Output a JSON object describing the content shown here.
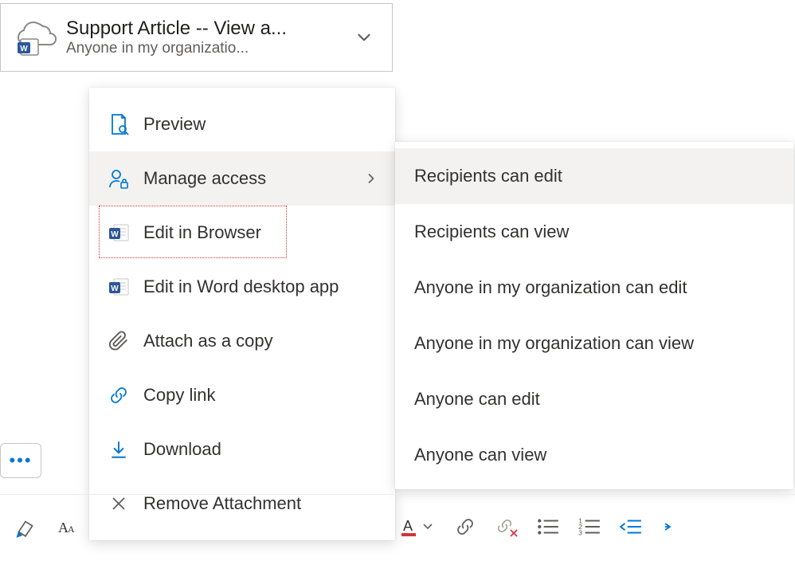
{
  "attachment": {
    "title": "Support Article -- View a...",
    "subtitle": "Anyone in my organizatio..."
  },
  "menu": {
    "preview": "Preview",
    "manage_access": "Manage access",
    "edit_browser": "Edit in Browser",
    "edit_desktop": "Edit in Word desktop app",
    "attach_copy": "Attach as a copy",
    "copy_link": "Copy link",
    "download": "Download",
    "remove": "Remove Attachment"
  },
  "submenu": {
    "recipients_edit": "Recipients can edit",
    "recipients_view": "Recipients can view",
    "org_edit": "Anyone in my organization can edit",
    "org_view": "Anyone in my organization can view",
    "anyone_edit": "Anyone can edit",
    "anyone_view": "Anyone can view"
  },
  "colors": {
    "accent": "#0078d4",
    "word_blue": "#2b579a",
    "red": "#d13438"
  }
}
